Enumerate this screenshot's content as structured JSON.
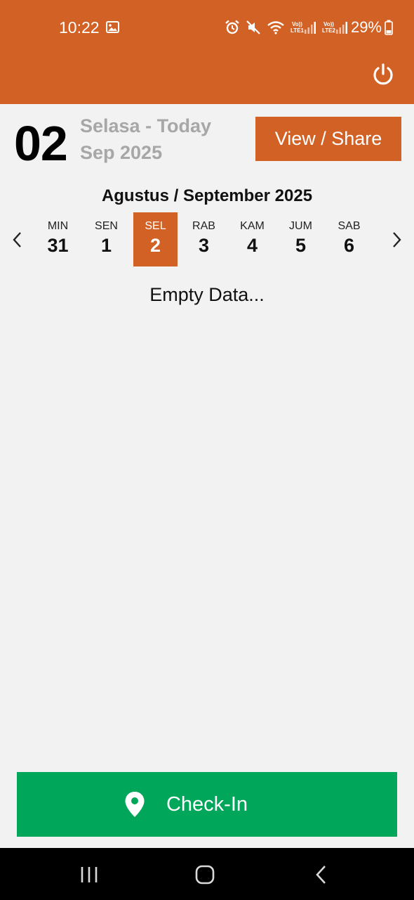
{
  "status_bar": {
    "time": "10:22",
    "sim1": {
      "top": "Vo))",
      "bottom": "LTE1"
    },
    "sim2": {
      "top": "Vo))",
      "bottom": "LTE2"
    },
    "battery": "29%"
  },
  "header": {
    "accent_color": "#d26125",
    "power_icon": "power-icon"
  },
  "date_header": {
    "day_number": "02",
    "day_label": "Selasa - Today",
    "month_label": "Sep 2025",
    "view_share_label": "View / Share"
  },
  "week": {
    "title": "Agustus / September 2025",
    "days": [
      {
        "name": "MIN",
        "date": "31",
        "selected": false
      },
      {
        "name": "SEN",
        "date": "1",
        "selected": false
      },
      {
        "name": "SEL",
        "date": "2",
        "selected": true
      },
      {
        "name": "RAB",
        "date": "3",
        "selected": false
      },
      {
        "name": "KAM",
        "date": "4",
        "selected": false
      },
      {
        "name": "JUM",
        "date": "5",
        "selected": false
      },
      {
        "name": "SAB",
        "date": "6",
        "selected": false
      }
    ]
  },
  "content": {
    "empty_text": "Empty Data..."
  },
  "checkin": {
    "label": "Check-In",
    "color": "#00a65a",
    "icon": "location-pin-icon"
  }
}
